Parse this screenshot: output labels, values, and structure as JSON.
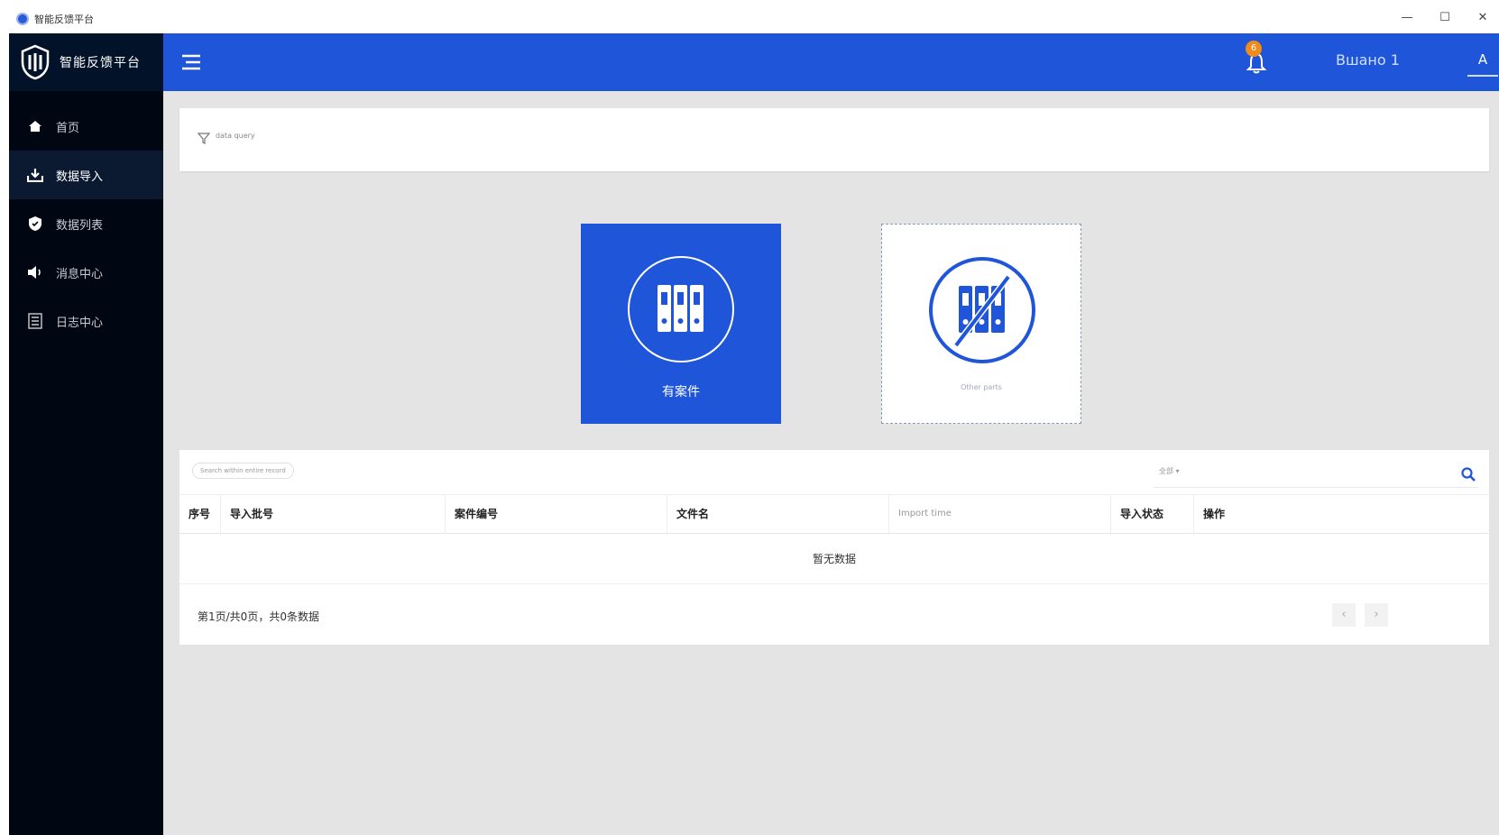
{
  "window": {
    "title": "智能反馈平台",
    "minimize": "—",
    "maximize": "☐",
    "close": "✕"
  },
  "sidebar": {
    "brand_name": "智能反馈平台",
    "items": [
      {
        "label": "首页",
        "icon": "home-icon"
      },
      {
        "label": "数据导入",
        "icon": "import-icon"
      },
      {
        "label": "数据列表",
        "icon": "shield-icon"
      },
      {
        "label": "消息中心",
        "icon": "speaker-icon"
      },
      {
        "label": "日志中心",
        "icon": "log-icon"
      }
    ]
  },
  "header": {
    "notification_count": "6",
    "username": "Вшано 1",
    "user_initial": "A"
  },
  "filter": {
    "label": "data query"
  },
  "tiles": {
    "primary_label": "有案件",
    "secondary_label": "Other parts"
  },
  "table": {
    "search_tag": "Search within entire record",
    "search_select": "全部 ▾",
    "search_placeholder": "",
    "columns": [
      {
        "label": "序号",
        "muted": false
      },
      {
        "label": "导入批号",
        "muted": false
      },
      {
        "label": "案件编号",
        "muted": false
      },
      {
        "label": "文件名",
        "muted": false
      },
      {
        "label": "Import time",
        "muted": true
      },
      {
        "label": "导入状态",
        "muted": false
      },
      {
        "label": "操作",
        "muted": false
      }
    ],
    "empty_text": "暂无数据",
    "pager_text": "第1页/共0页，共0条数据",
    "prev": "‹",
    "next": "›"
  },
  "colors": {
    "accent": "#1f55d8",
    "sidebar_bg": "#000612",
    "content_bg": "#e4e4e4",
    "badge": "#f28b1a"
  }
}
